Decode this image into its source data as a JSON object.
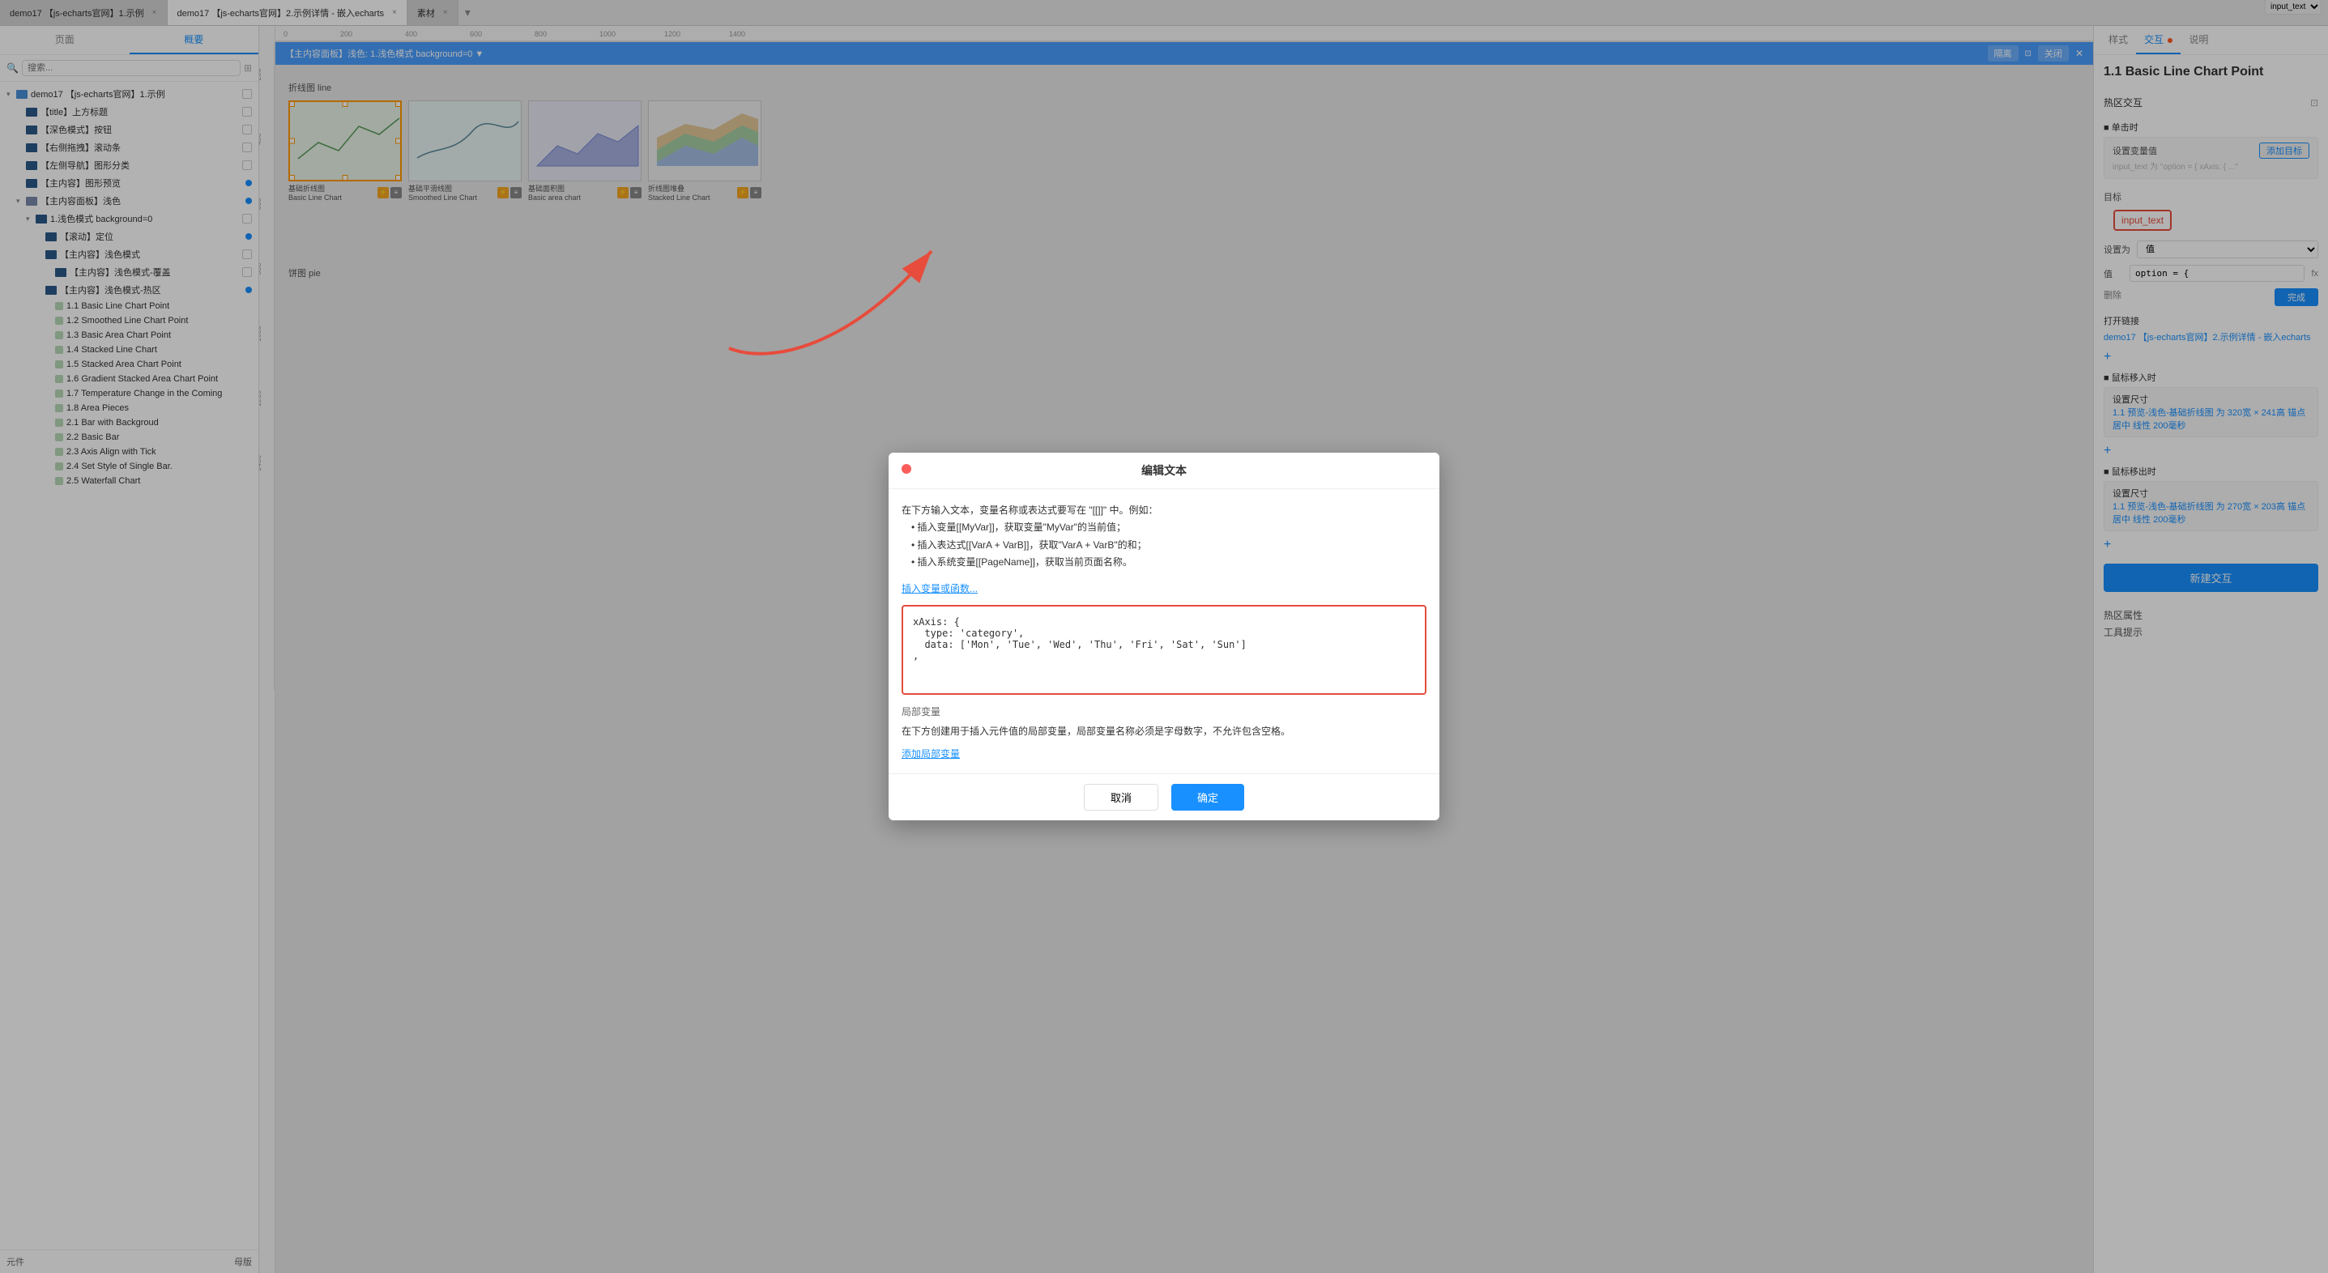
{
  "tabs": [
    {
      "id": "tab1",
      "label": "demo17 【js-echarts官网】1.示例",
      "active": false
    },
    {
      "id": "tab2",
      "label": "demo17 【js-echarts官网】2.示例详情 - 嵌入echarts",
      "active": true
    },
    {
      "id": "tab3",
      "label": "素材",
      "active": false
    }
  ],
  "leftPanel": {
    "tabs": [
      "页面",
      "概要"
    ],
    "activeTab": "概要",
    "searchPlaceholder": "搜索...",
    "treeItems": [
      {
        "id": "root",
        "label": "demo17 【js-echarts官网】1.示例",
        "level": 0,
        "type": "folder",
        "expanded": true
      },
      {
        "id": "title",
        "label": "【title】上方标题",
        "level": 1,
        "type": "folder-dark"
      },
      {
        "id": "dark-btn",
        "label": "【深色模式】按钮",
        "level": 1,
        "type": "folder-dark"
      },
      {
        "id": "right-scroll",
        "label": "【右侧拖拽】滚动条",
        "level": 1,
        "type": "folder-dark"
      },
      {
        "id": "left-nav",
        "label": "【左侧导航】图形分类",
        "level": 1,
        "type": "folder-dark"
      },
      {
        "id": "main-preview",
        "label": "【主内容】图形预览",
        "level": 1,
        "type": "folder-dark",
        "checked": true
      },
      {
        "id": "main-panel-light",
        "label": "【主内容面板】浅色",
        "level": 1,
        "type": "layers",
        "expanded": true,
        "checked": true
      },
      {
        "id": "light-mode",
        "label": "1.浅色模式 background=0",
        "level": 2,
        "type": "folder-dark",
        "expanded": true
      },
      {
        "id": "scroll-pos",
        "label": "【滚动】定位",
        "level": 3,
        "type": "folder-dark",
        "checked": true
      },
      {
        "id": "main-light-mode",
        "label": "【主内容】浅色模式",
        "level": 3,
        "type": "folder-dark"
      },
      {
        "id": "main-cover",
        "label": "【主内容】浅色模式-覆盖",
        "level": 4,
        "type": "folder-dark"
      },
      {
        "id": "main-hotspot",
        "label": "【主内容】浅色模式-热区",
        "level": 3,
        "type": "folder-dark",
        "checked": true
      },
      {
        "id": "item-1-1",
        "label": "1.1 Basic Line Chart Point",
        "level": 4,
        "type": "dot"
      },
      {
        "id": "item-1-2",
        "label": "1.2 Smoothed Line Chart Point",
        "level": 4,
        "type": "dot"
      },
      {
        "id": "item-1-3",
        "label": "1.3 Basic Area Chart Point",
        "level": 4,
        "type": "dot"
      },
      {
        "id": "item-1-4",
        "label": "1.4 Stacked Line Chart",
        "level": 4,
        "type": "dot"
      },
      {
        "id": "item-1-5",
        "label": "1.5 Stacked Area Chart Point",
        "level": 4,
        "type": "dot"
      },
      {
        "id": "item-1-6",
        "label": "1.6 Gradient Stacked Area Chart Point",
        "level": 4,
        "type": "dot"
      },
      {
        "id": "item-1-7",
        "label": "1.7 Temperature Change in the Coming",
        "level": 4,
        "type": "dot"
      },
      {
        "id": "item-1-8",
        "label": "1.8 Area Pieces",
        "level": 4,
        "type": "dot"
      },
      {
        "id": "item-2-1",
        "label": "2.1 Bar with Backgroud",
        "level": 4,
        "type": "dot"
      },
      {
        "id": "item-2-2",
        "label": "2.2 Basic Bar",
        "level": 4,
        "type": "dot"
      },
      {
        "id": "item-2-3",
        "label": "2.3 Axis Align with Tick",
        "level": 4,
        "type": "dot"
      },
      {
        "id": "item-2-4",
        "label": "2.4 Set Style of Single Bar.",
        "level": 4,
        "type": "dot"
      },
      {
        "id": "item-2-5",
        "label": "2.5 Waterfall Chart",
        "level": 4,
        "type": "dot"
      }
    ],
    "bottomTabs": [
      "元件",
      "母版"
    ]
  },
  "canvasOverlay": {
    "title": "【主内容面板】浅色: 1.浅色模式 background=0 ▼",
    "isolate": "隔离",
    "close": "关闭"
  },
  "chartPreviews": {
    "row1": [
      {
        "label": "基础折线图\nBasic Line Chart",
        "selected": true
      },
      {
        "label": "基础平滑线图\nSmoothed Line Chart"
      },
      {
        "label": "基础面积图\nBasic area chart"
      },
      {
        "label": "折线图堆叠\nStacked Line Chart"
      }
    ]
  },
  "dialog": {
    "title": "编辑文本",
    "description": "在下方输入文本，变量名称或表达式要写在 \"[[]]\" 中。例如：",
    "bullets": [
      "插入变量[[MyVar]]，获取变量\"MyVar\"的当前值；",
      "插入表达式[[VarA + VarB]]，获取\"VarA + VarB\"的和；",
      "插入系统变量[[PageName]]，获取当前页面名称。"
    ],
    "insertLink": "插入变量或函数...",
    "codeValue": "xAxis: {\n  type: 'category',\n  data: ['Mon', 'Tue', 'Wed', 'Thu', 'Fri', 'Sat', 'Sun']\n,",
    "localVarTitle": "局部变量",
    "localVarDesc": "在下方创建用于插入元件值的局部变量，局部变量名称必须是字母数字，不允许包含空格。",
    "addVarLink": "添加局部变量",
    "cancelBtn": "取消",
    "confirmBtn": "确定"
  },
  "rightPanel": {
    "tabs": [
      "样式",
      "交互",
      "说明"
    ],
    "activeTab": "交互",
    "pageTitle": "1.1 Basic Line Chart Point",
    "hotInteraction": "热区交互",
    "singleClick": {
      "label": "■ 单击时",
      "action": "设置变量值",
      "addTarget": "添加目标",
      "inputPlaceholder": "input_text 为 \"option = { xAxis: { ...\"",
      "targetLabel": "目标",
      "targetValue": "input_text",
      "setToLabel": "设置为",
      "setToValue": "值",
      "valueLabel": "值",
      "valueContent": "option = {",
      "fxBtn": "fx",
      "deleteLabel": "删除",
      "doneLabel": "完成"
    },
    "openLink": {
      "label": "打开链接",
      "target": "demo17 【js-echarts官网】2.示例详情 - 嵌入echarts",
      "plus": "+"
    },
    "mouseEnter": {
      "label": "■ 鼠标移入时",
      "action": "设置尺寸",
      "detail": "1.1 预览-浅色-基础折线图 为 320宽 × 241高 锚点 居中 线性 200毫秒"
    },
    "mouseLeave": {
      "label": "■ 鼠标移出时",
      "action": "设置尺寸",
      "detail": "1.1 预览-浅色-基础折线图 为 270宽 × 203高 锚点 居中 线性 200毫秒"
    },
    "newInteractionBtn": "新建交互",
    "hotspotSection": {
      "label": "热区属性",
      "tooltip": "工具提示"
    }
  }
}
